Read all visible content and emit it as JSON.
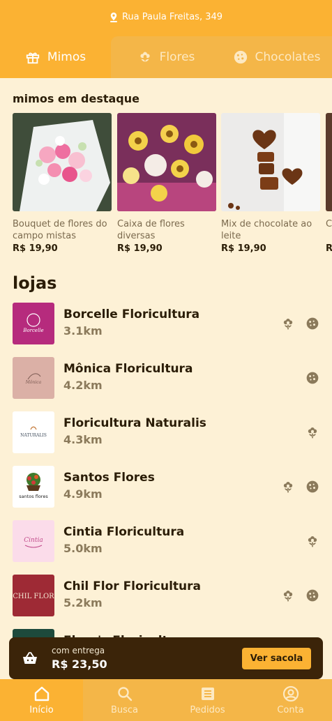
{
  "header": {
    "address": "Rua Paula Freitas, 349",
    "tabs": [
      {
        "label": "Mimos",
        "icon": "gift-icon"
      },
      {
        "label": "Flores",
        "icon": "flower-icon"
      },
      {
        "label": "Chocolates",
        "icon": "cookie-icon"
      }
    ]
  },
  "featured": {
    "title": "mimos em destaque",
    "items": [
      {
        "name": "Bouquet de flores do campo mistas",
        "price": "R$ 19,90"
      },
      {
        "name": "Caixa de flores diversas",
        "price": "R$ 19,90"
      },
      {
        "name": "Mix de chocolate ao leite",
        "price": "R$ 19,90"
      },
      {
        "name": "Ca fo",
        "price": "R$"
      }
    ]
  },
  "stores": {
    "title": "lojas",
    "items": [
      {
        "name": "Borcelle Floricultura",
        "distance": "3.1km",
        "flowers": true,
        "chocolates": true
      },
      {
        "name": "Mônica Floricultura",
        "distance": "4.2km",
        "flowers": false,
        "chocolates": true
      },
      {
        "name": "Floricultura Naturalis",
        "distance": "4.3km",
        "flowers": true,
        "chocolates": false
      },
      {
        "name": "Santos Flores",
        "distance": "4.9km",
        "flowers": true,
        "chocolates": true
      },
      {
        "name": "Cintia Floricultura",
        "distance": "5.0km",
        "flowers": true,
        "chocolates": false
      },
      {
        "name": "Chil Flor Floricultura",
        "distance": "5.2km",
        "flowers": true,
        "chocolates": true
      },
      {
        "name": "Flora's Floricultura",
        "distance": "",
        "flowers": false,
        "chocolates": false
      }
    ],
    "logo_texts": [
      "Borcelle",
      "Mônica",
      "NATURALIS",
      "santos flores",
      "Cintia",
      "CHIL FLOR"
    ]
  },
  "cart": {
    "label": "com entrega",
    "total": "R$ 23,50",
    "button": "Ver sacola"
  },
  "nav": [
    {
      "label": "Início",
      "icon": "home-icon"
    },
    {
      "label": "Busca",
      "icon": "search-icon"
    },
    {
      "label": "Pedidos",
      "icon": "orders-icon"
    },
    {
      "label": "Conta",
      "icon": "account-icon"
    }
  ],
  "colors": {
    "accent": "#fbb233",
    "background": "#fdf1d6",
    "dark": "#3b2409",
    "text": "#2b1d07"
  }
}
